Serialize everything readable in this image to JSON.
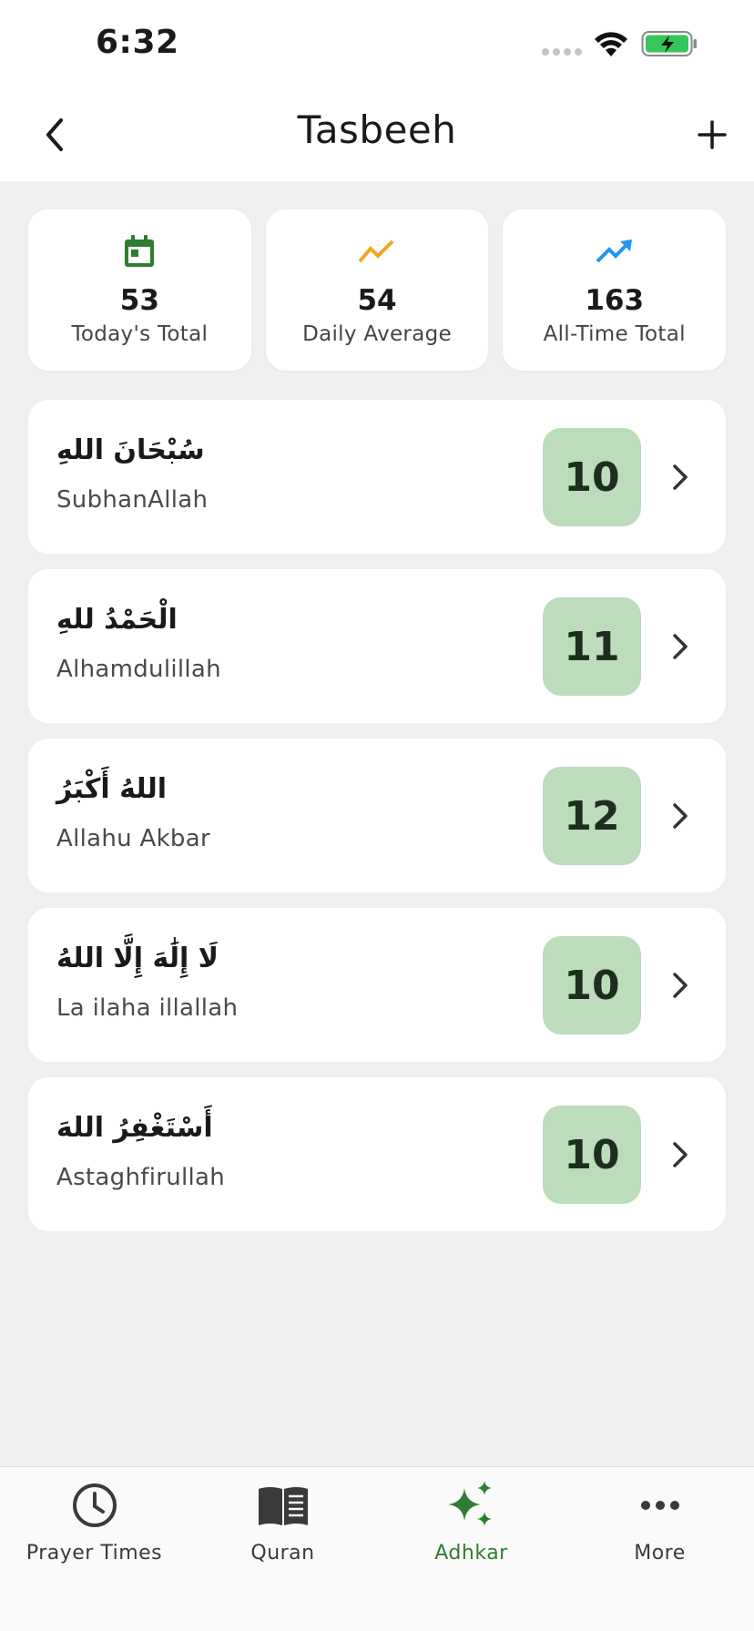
{
  "status_bar": {
    "time": "6:32"
  },
  "header": {
    "title": "Tasbeeh"
  },
  "stats": [
    {
      "icon": "calendar-icon",
      "value": "53",
      "label": "Today's Total",
      "color": "#2e7d32"
    },
    {
      "icon": "trending-icon",
      "value": "54",
      "label": "Daily Average",
      "color": "#f5a524"
    },
    {
      "icon": "trending-up-icon",
      "value": "163",
      "label": "All-Time Total",
      "color": "#2196f3"
    }
  ],
  "dhikr": [
    {
      "arabic": "سُبْحَانَ اللهِ",
      "latin": "SubhanAllah",
      "count": "10"
    },
    {
      "arabic": "الْحَمْدُ للهِ",
      "latin": "Alhamdulillah",
      "count": "11"
    },
    {
      "arabic": "اللهُ أَكْبَرُ",
      "latin": "Allahu Akbar",
      "count": "12"
    },
    {
      "arabic": "لَا إِلَٰهَ إِلَّا اللهُ",
      "latin": "La ilaha illallah",
      "count": "10"
    },
    {
      "arabic": "أَسْتَغْفِرُ اللهَ",
      "latin": "Astaghfirullah",
      "count": "10"
    }
  ],
  "tabs": [
    {
      "label": "Prayer Times",
      "icon": "clock-icon",
      "active": false
    },
    {
      "label": "Quran",
      "icon": "book-icon",
      "active": false
    },
    {
      "label": "Adhkar",
      "icon": "sparkles-icon",
      "active": true
    },
    {
      "label": "More",
      "icon": "more-icon",
      "active": false
    }
  ],
  "colors": {
    "accent": "#2e7d32",
    "count_badge": "#bcdcbc",
    "background": "#efefef"
  }
}
